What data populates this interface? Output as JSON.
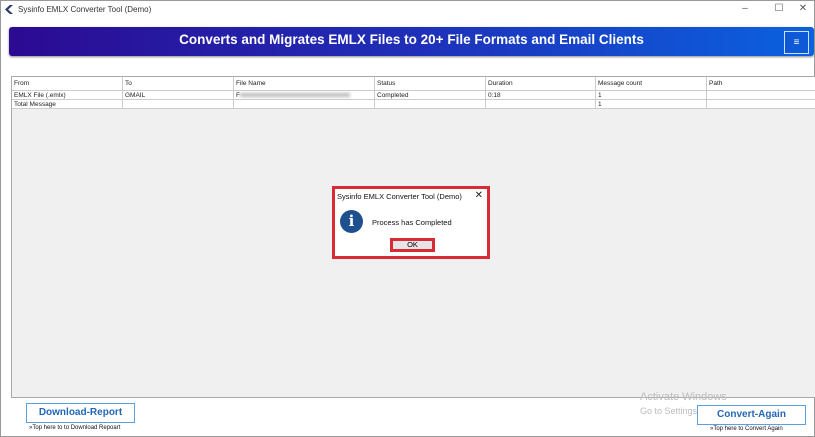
{
  "window": {
    "title": "Sysinfo EMLX Converter Tool (Demo)",
    "minimize": "–",
    "maximize": "☐",
    "close": "✕"
  },
  "banner": {
    "title": "Converts and Migrates EMLX Files to 20+ File Formats and Email Clients",
    "menu_icon": "≡"
  },
  "table": {
    "headers": [
      "From",
      "To",
      "File Name",
      "Status",
      "Duration",
      "Message count",
      "Path"
    ],
    "rows": [
      [
        "EMLX File (.emlx)",
        "GMAIL",
        "",
        "Completed",
        "0:18",
        "1",
        ""
      ],
      [
        "Total Message",
        "",
        "",
        "",
        "",
        "1",
        ""
      ]
    ]
  },
  "dialog": {
    "title": "Sysinfo EMLX Converter Tool (Demo)",
    "message": "Process has Completed",
    "ok": "OK",
    "close": "✕",
    "icon": "i"
  },
  "footer": {
    "download": "Download-Report",
    "download_hint": "»Top here to to Download Repoart",
    "convert": "Convert-Again",
    "convert_hint": "»Top here to Convert Again"
  },
  "watermark": {
    "line1": "Activate Windows",
    "line2": "Go to Settings to activate Windows."
  }
}
